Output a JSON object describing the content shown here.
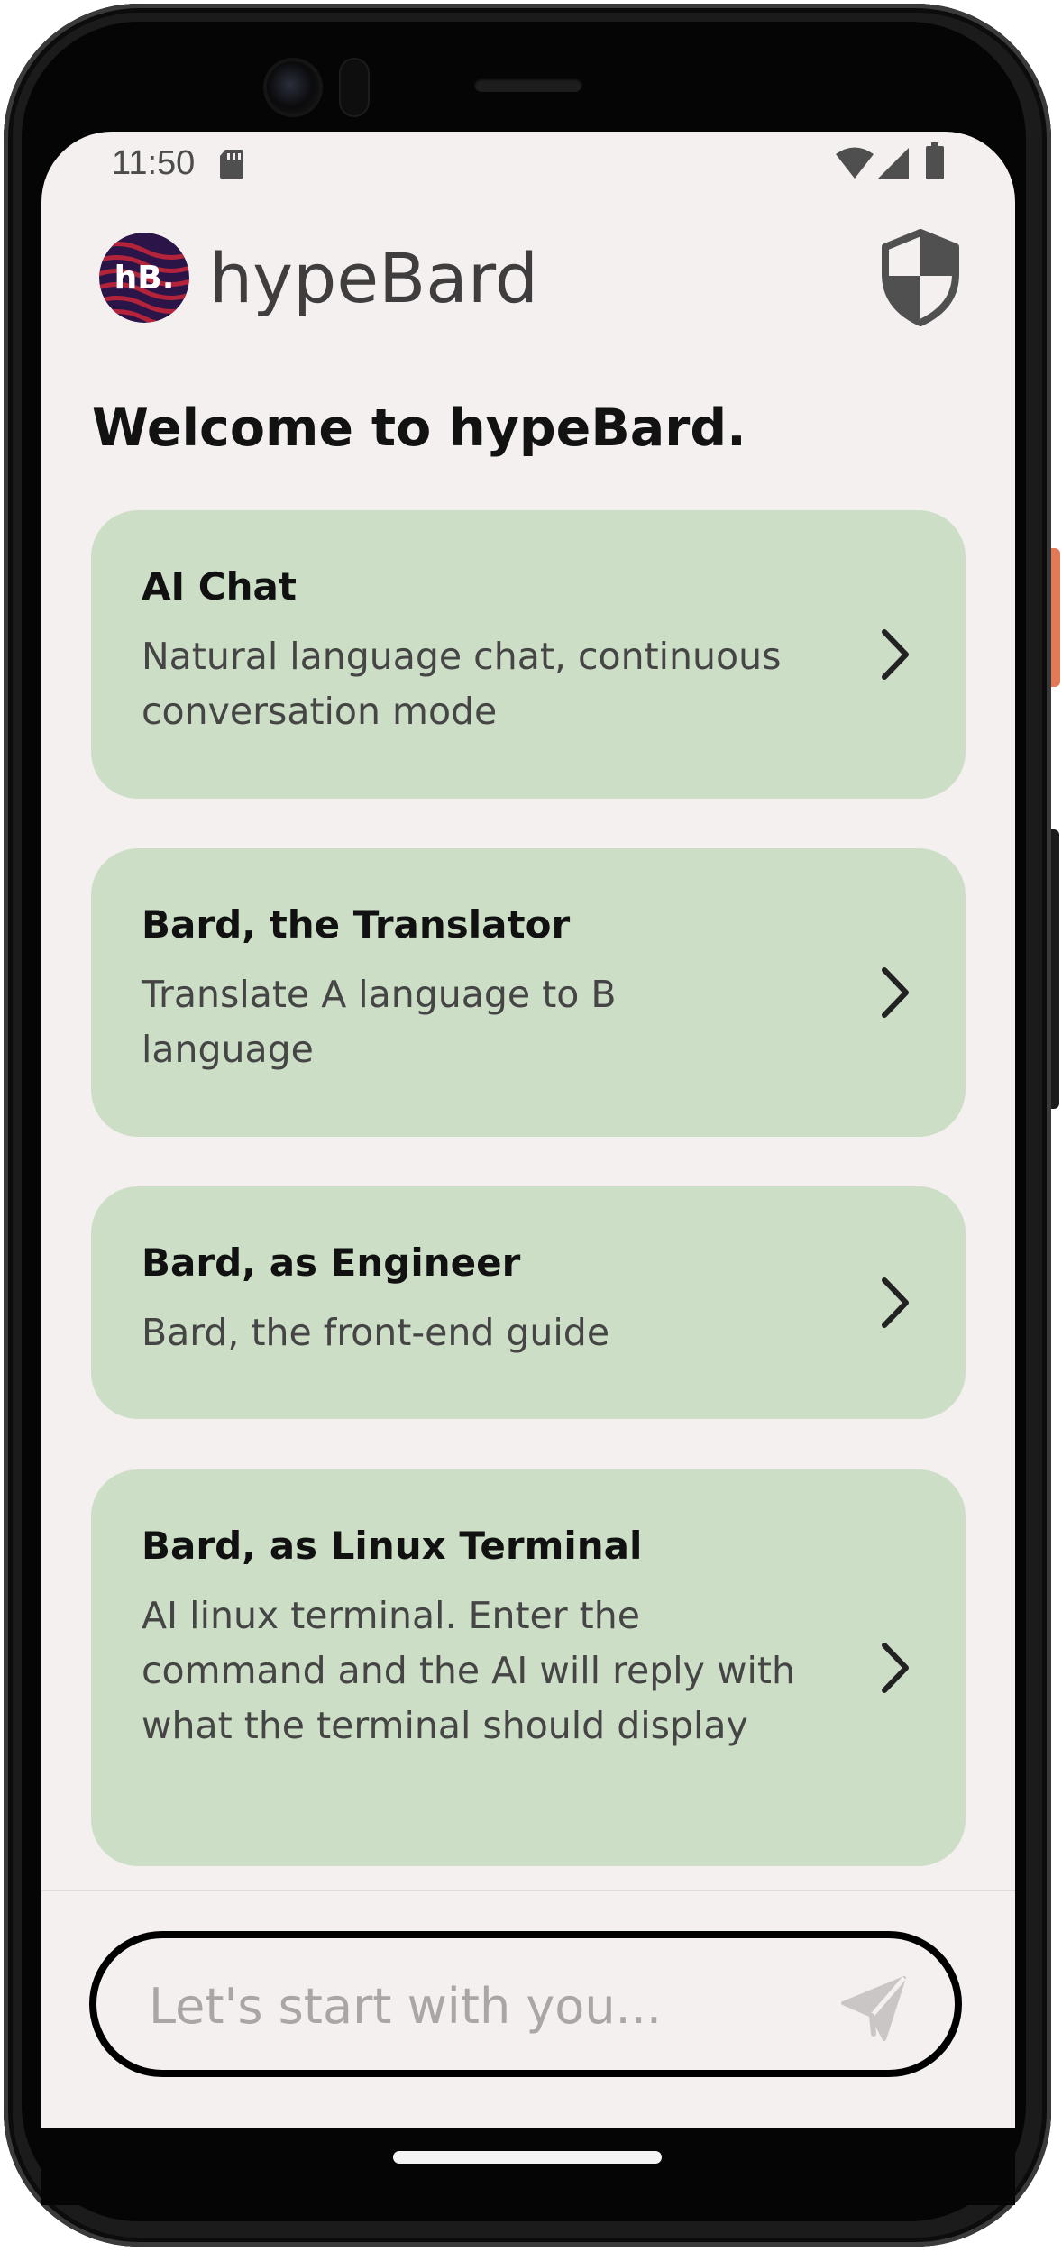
{
  "status_bar": {
    "time": "11:50",
    "icons": [
      "sd-card-icon",
      "wifi-icon",
      "signal-icon",
      "battery-icon"
    ]
  },
  "header": {
    "logo_text": "hB.",
    "app_name": "hypeBard",
    "privacy_icon": "shield-icon"
  },
  "welcome": "Welcome to hypeBard.",
  "cards": [
    {
      "title": "AI Chat",
      "description": "Natural language chat, continuous conversation mode"
    },
    {
      "title": "Bard, the Translator",
      "description": "Translate A language to B language"
    },
    {
      "title": "Bard, as Engineer",
      "description": "Bard, the front-end guide"
    },
    {
      "title": "Bard, as Linux Terminal",
      "description": "AI linux terminal. Enter the command and the AI will reply with what the terminal should display"
    }
  ],
  "composer": {
    "placeholder": "Let's start with you...",
    "value": "",
    "send_icon": "send-icon"
  },
  "colors": {
    "screen_bg": "#f3f0ef",
    "card_bg": "#cddec7",
    "input_border": "#000000",
    "placeholder": "#a9a6a5",
    "logo_bg": "#2a1448",
    "logo_accent": "#b3243a"
  }
}
